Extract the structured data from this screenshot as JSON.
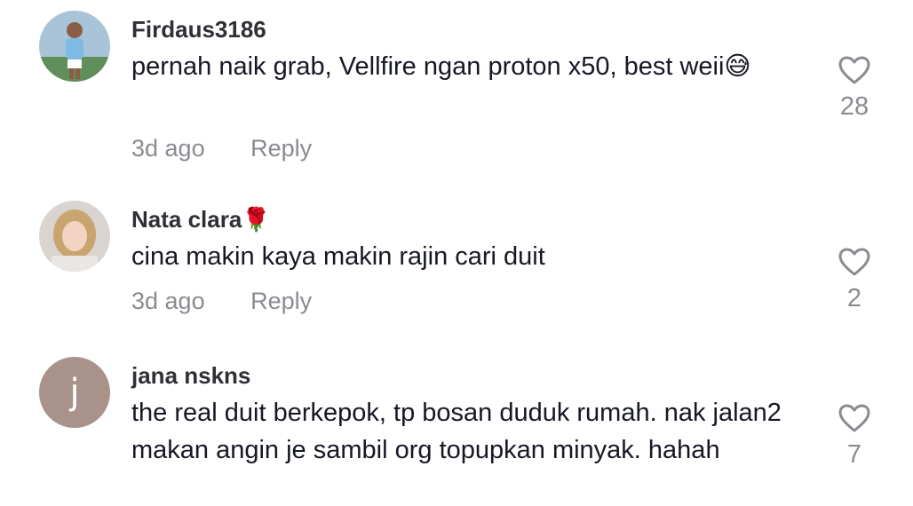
{
  "comments": [
    {
      "username": "Firdaus3186",
      "text": "pernah naik grab, Vellfire ngan proton x50, best weii😅",
      "time": "3d ago",
      "reply": "Reply",
      "likes": "28"
    },
    {
      "username": "Nata clara🌹",
      "text": "cina makin kaya makin rajin cari duit",
      "time": "3d ago",
      "reply": "Reply",
      "likes": "2"
    },
    {
      "username": "jana nskns",
      "avatar_letter": "j",
      "text": "the real duit berkepok, tp bosan duduk rumah. nak jalan2 makan angin je sambil org topupkan minyak. hahah",
      "likes": "7"
    }
  ],
  "icons": {
    "like": "heart-outline-icon"
  },
  "colors": {
    "text": "#161823",
    "muted": "#8a8b91",
    "avatar_bg": "#a8928a"
  }
}
